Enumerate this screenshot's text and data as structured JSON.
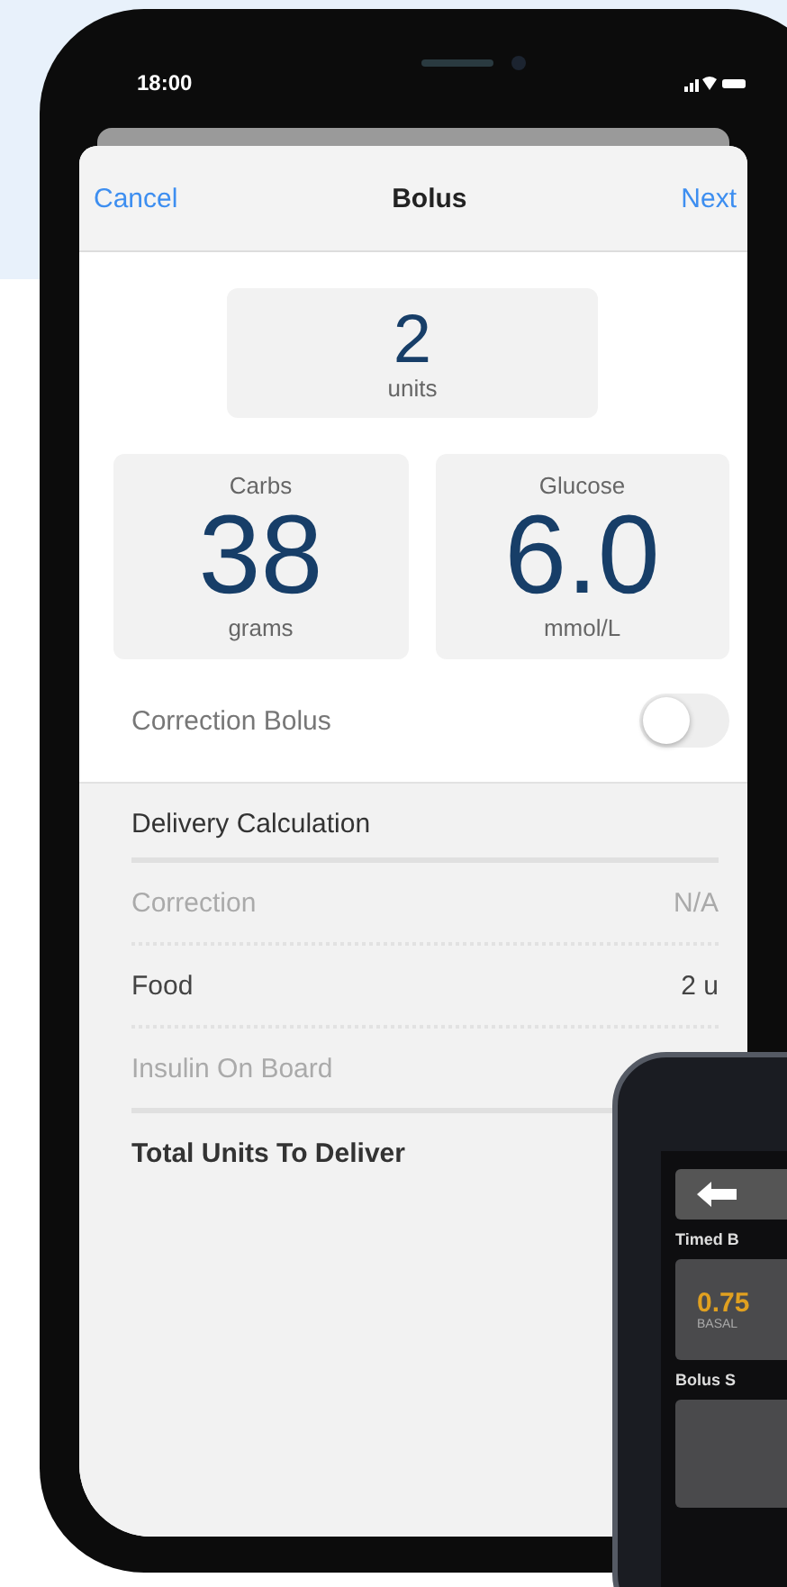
{
  "status_bar": {
    "time": "18:00"
  },
  "nav": {
    "cancel": "Cancel",
    "title": "Bolus",
    "next": "Next"
  },
  "units": {
    "value": "2",
    "unit": "units"
  },
  "cards": [
    {
      "label": "Carbs",
      "value": "38",
      "unit": "grams"
    },
    {
      "label": "Glucose",
      "value": "6.0",
      "unit": "mmol/L"
    }
  ],
  "correction_bolus": {
    "label": "Correction Bolus",
    "on": false
  },
  "delivery": {
    "title": "Delivery Calculation",
    "rows": [
      {
        "label": "Correction",
        "value": "N/A",
        "kind": "dimmed"
      },
      {
        "label": "Food",
        "value": "2 u",
        "kind": "normal"
      },
      {
        "label": "Insulin On Board",
        "kind": "dimmed"
      },
      {
        "label": "Total Units To Deliver",
        "kind": "total"
      }
    ]
  },
  "pump": {
    "section_1": "Timed B",
    "tile_value": "0.75",
    "tile_label": "BASAL",
    "section_2": "Bolus S"
  }
}
